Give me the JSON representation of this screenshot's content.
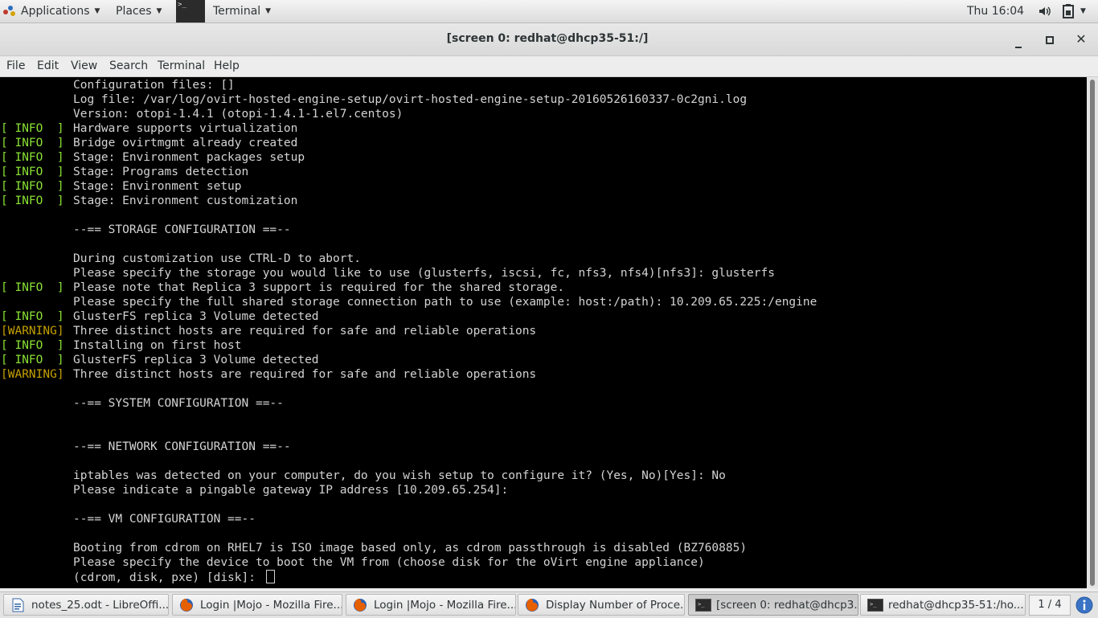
{
  "top_panel": {
    "applications": "Applications",
    "places": "Places",
    "terminal": "Terminal",
    "clock": "Thu 16:04"
  },
  "window": {
    "title": "[screen 0: redhat@dhcp35-51:/]"
  },
  "menubar": [
    "File",
    "Edit",
    "View",
    "Search",
    "Terminal",
    "Help"
  ],
  "terminal": {
    "lines": [
      {
        "tag": "",
        "text": "Configuration files: []"
      },
      {
        "tag": "",
        "text": "Log file: /var/log/ovirt-hosted-engine-setup/ovirt-hosted-engine-setup-20160526160337-0c2gni.log"
      },
      {
        "tag": "",
        "text": "Version: otopi-1.4.1 (otopi-1.4.1-1.el7.centos)"
      },
      {
        "tag": "[ INFO  ]",
        "level": "info",
        "text": "Hardware supports virtualization"
      },
      {
        "tag": "[ INFO  ]",
        "level": "info",
        "text": "Bridge ovirtmgmt already created"
      },
      {
        "tag": "[ INFO  ]",
        "level": "info",
        "text": "Stage: Environment packages setup"
      },
      {
        "tag": "[ INFO  ]",
        "level": "info",
        "text": "Stage: Programs detection"
      },
      {
        "tag": "[ INFO  ]",
        "level": "info",
        "text": "Stage: Environment setup"
      },
      {
        "tag": "[ INFO  ]",
        "level": "info",
        "text": "Stage: Environment customization"
      },
      {
        "tag": "",
        "text": ""
      },
      {
        "tag": "",
        "text": "--== STORAGE CONFIGURATION ==--"
      },
      {
        "tag": "",
        "text": ""
      },
      {
        "tag": "",
        "text": "During customization use CTRL-D to abort."
      },
      {
        "tag": "",
        "text": "Please specify the storage you would like to use (glusterfs, iscsi, fc, nfs3, nfs4)[nfs3]: glusterfs"
      },
      {
        "tag": "[ INFO  ]",
        "level": "info",
        "text": "Please note that Replica 3 support is required for the shared storage."
      },
      {
        "tag": "",
        "text": "Please specify the full shared storage connection path to use (example: host:/path): 10.209.65.225:/engine"
      },
      {
        "tag": "[ INFO  ]",
        "level": "info",
        "text": "GlusterFS replica 3 Volume detected"
      },
      {
        "tag": "[WARNING]",
        "level": "warning",
        "text": "Three distinct hosts are required for safe and reliable operations"
      },
      {
        "tag": "[ INFO  ]",
        "level": "info",
        "text": "Installing on first host"
      },
      {
        "tag": "[ INFO  ]",
        "level": "info",
        "text": "GlusterFS replica 3 Volume detected"
      },
      {
        "tag": "[WARNING]",
        "level": "warning",
        "text": "Three distinct hosts are required for safe and reliable operations"
      },
      {
        "tag": "",
        "text": ""
      },
      {
        "tag": "",
        "text": "--== SYSTEM CONFIGURATION ==--"
      },
      {
        "tag": "",
        "text": ""
      },
      {
        "tag": "",
        "text": ""
      },
      {
        "tag": "",
        "text": "--== NETWORK CONFIGURATION ==--"
      },
      {
        "tag": "",
        "text": ""
      },
      {
        "tag": "",
        "text": "iptables was detected on your computer, do you wish setup to configure it? (Yes, No)[Yes]: No"
      },
      {
        "tag": "",
        "text": "Please indicate a pingable gateway IP address [10.209.65.254]:"
      },
      {
        "tag": "",
        "text": ""
      },
      {
        "tag": "",
        "text": "--== VM CONFIGURATION ==--"
      },
      {
        "tag": "",
        "text": ""
      },
      {
        "tag": "",
        "text": "Booting from cdrom on RHEL7 is ISO image based only, as cdrom passthrough is disabled (BZ760885)"
      },
      {
        "tag": "",
        "text": "Please specify the device to boot the VM from (choose disk for the oVirt engine appliance)"
      },
      {
        "tag": "",
        "text": "(cdrom, disk, pxe) [disk]: ",
        "cursor": true
      }
    ]
  },
  "taskbar": {
    "tasks": [
      {
        "label": "notes_25.odt - LibreOffi...",
        "icon": "libreoffice-writer-icon",
        "active": false
      },
      {
        "label": "Login |Mojo - Mozilla Fire...",
        "icon": "firefox-icon",
        "active": false
      },
      {
        "label": "Login |Mojo - Mozilla Fire...",
        "icon": "firefox-icon",
        "active": false
      },
      {
        "label": "Display Number of Proce...",
        "icon": "firefox-icon",
        "active": false
      },
      {
        "label": "[screen 0: redhat@dhcp3...",
        "icon": "terminal-icon",
        "active": true
      },
      {
        "label": "redhat@dhcp35-51:/ho...",
        "icon": "terminal-icon",
        "active": false
      }
    ],
    "workspace": "1 / 4"
  },
  "colors": {
    "info": "#8ae234",
    "warning": "#c4a000",
    "terminal_text": "#d3d3d3",
    "terminal_bg": "#000000"
  }
}
